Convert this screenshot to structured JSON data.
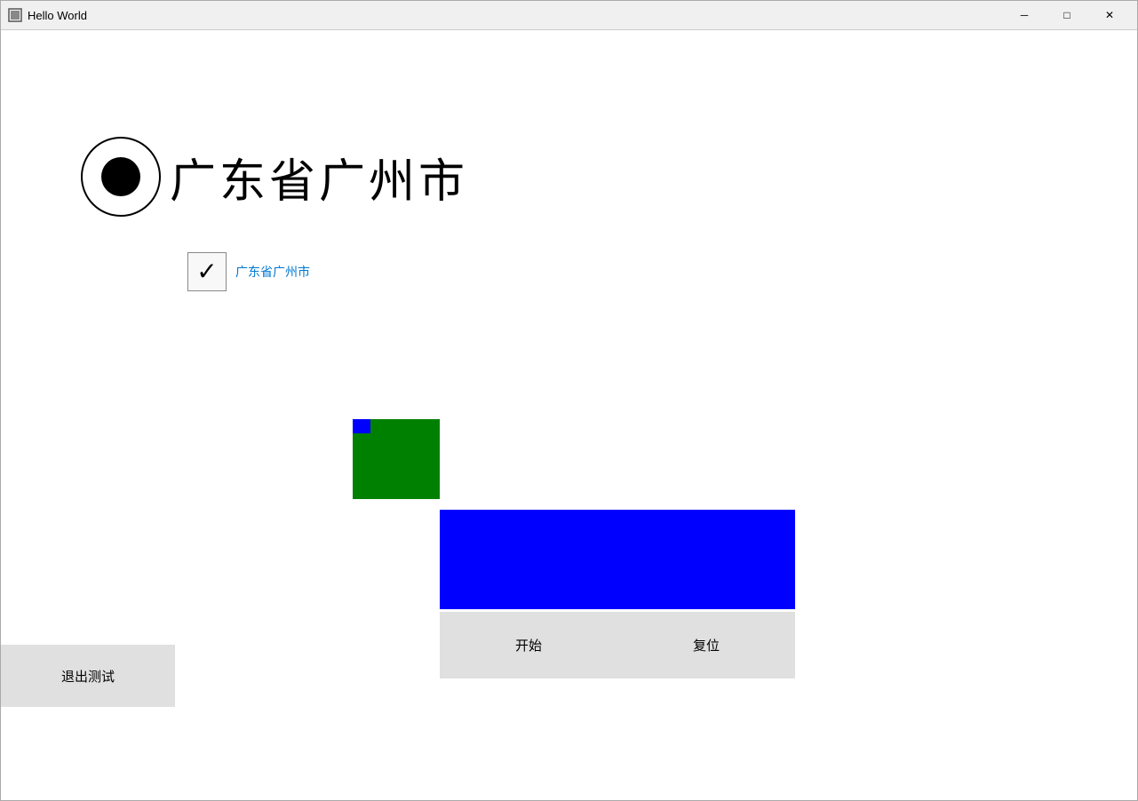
{
  "window": {
    "title": "Hello World",
    "icon": "□"
  },
  "titlebar": {
    "minimize_label": "─",
    "maximize_label": "□",
    "close_label": "✕"
  },
  "radio": {
    "label": "广东省广州市"
  },
  "checkbox": {
    "label": "广东省广州市",
    "checked": true,
    "check_symbol": "✓"
  },
  "colors": {
    "green": "#008000",
    "blue": "#0000ff",
    "panel_bg": "#e0e0e0"
  },
  "buttons": {
    "start_label": "开始",
    "reset_label": "复位",
    "exit_label": "退出测试"
  }
}
